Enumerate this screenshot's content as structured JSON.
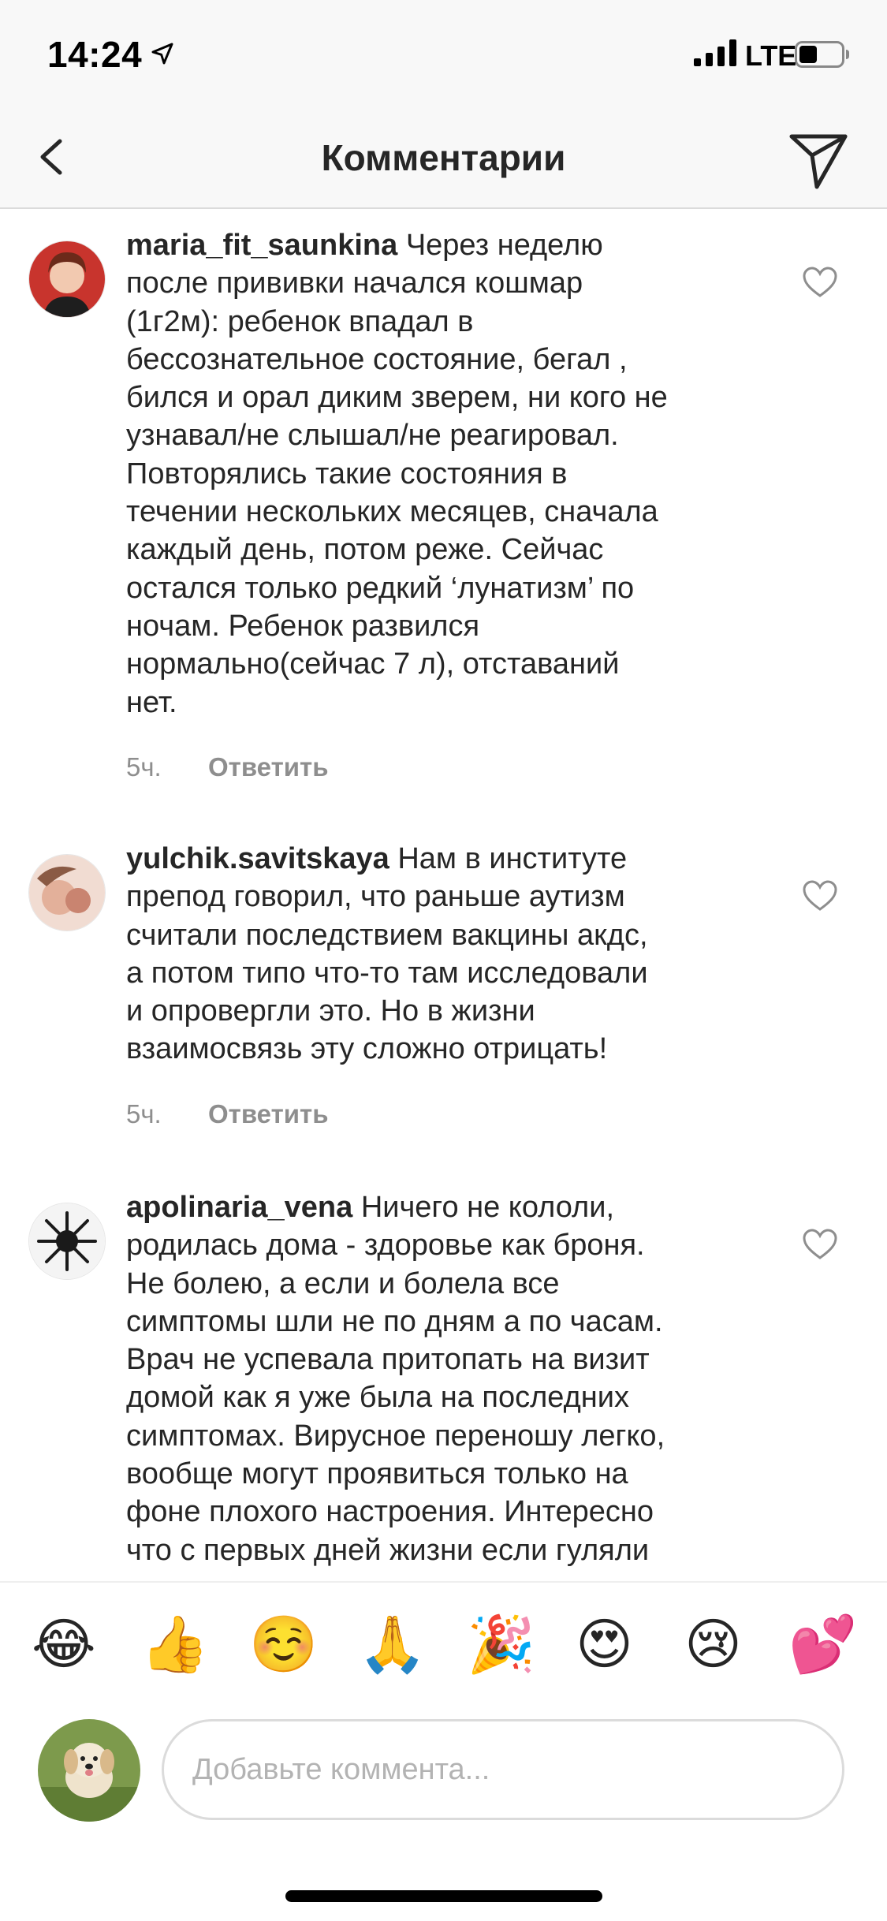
{
  "status_bar": {
    "time": "14:24",
    "network": "LTE",
    "icons": [
      "location-arrow-icon",
      "signal-bars-icon",
      "battery-icon"
    ]
  },
  "header": {
    "title": "Комментарии",
    "back_icon": "chevron-left-icon",
    "share_icon": "paper-plane-icon"
  },
  "comments": [
    {
      "username": "maria_fit_saunkina",
      "text": "Через неделю\nпосле прививки начался кошмар\n(1г2м): ребенок впадал в\nбессознательное состояние, бегал ,\nбился и орал диким зверем, ни кого не\nузнавал/не слышал/не реагировал.\nПовторялись такие состояния в\nтечении нескольких месяцев, сначала\nкаждый день, потом реже. Сейчас\nостался только редкий ‘лунатизм’ по\nночам. Ребенок развился\nнормально(сейчас 7 л), отставаний\nнет.",
      "time": "5ч.",
      "reply": "Ответить"
    },
    {
      "username": "yulchik.savitskaya",
      "text": "Нам в институте\nпрепод говорил, что раньше аутизм\nсчитали последствием вакцины акдс,\nа потом типо что-то там исследовали\nи опровергли это. Но в жизни\nвзаимосвязь эту сложно отрицать!",
      "time": "5ч.",
      "reply": "Ответить"
    },
    {
      "username": "apolinaria_vena",
      "text": "Ничего не кололи,\nродилась дома - здоровье как броня.\nНе болею, а если и болела все\nсимптомы шли не по дням а по часам.\nВрач не успевала притопать на визит\nдомой как я уже была на последних\nсимптомах. Вирусное переношу легко,\nвообще могут проявиться только на\nфоне плохого настроения. Интересно\nчто с первых дней жизни если гуляли",
      "time": "",
      "reply": ""
    }
  ],
  "emoji_bar": [
    "😂",
    "👍",
    "☺️",
    "🙏",
    "🎉",
    "😍",
    "😢",
    "💕"
  ],
  "composer": {
    "placeholder": "Добавьте коммента..."
  },
  "colors": {
    "text": "#262626",
    "secondary": "#8e8e8e",
    "border": "#dbdbdb",
    "bar_background": "#f8f8f8"
  }
}
